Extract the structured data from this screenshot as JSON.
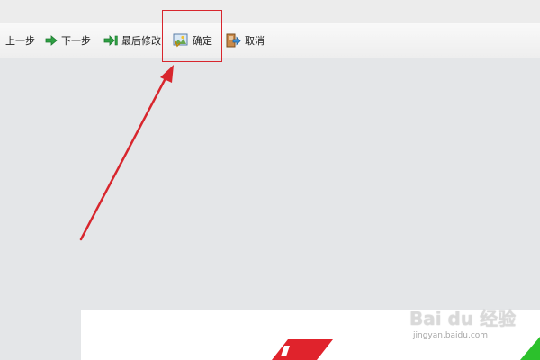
{
  "toolbar": {
    "items": [
      {
        "label": "上一步",
        "icon": "previous-step-icon"
      },
      {
        "label": "下一步",
        "icon": "green-arrow-right-icon"
      },
      {
        "label": "最后修改",
        "icon": "last-edit-icon"
      },
      {
        "label": "确定",
        "icon": "image-confirm-icon"
      },
      {
        "label": "取消",
        "icon": "cancel-icon"
      }
    ]
  },
  "annotation": {
    "highlight_color": "#d8262d",
    "target": "确定"
  },
  "watermark": {
    "brand": "Bai du 经验",
    "url": "jingyan.baidu.com"
  },
  "colors": {
    "background": "#e4e6e8",
    "toolbar": "#f2f2f2",
    "arrow_red": "#d8262d",
    "green_icon": "#2ea043",
    "badge_red": "#e0232c",
    "badge_green": "#2cc12c"
  }
}
